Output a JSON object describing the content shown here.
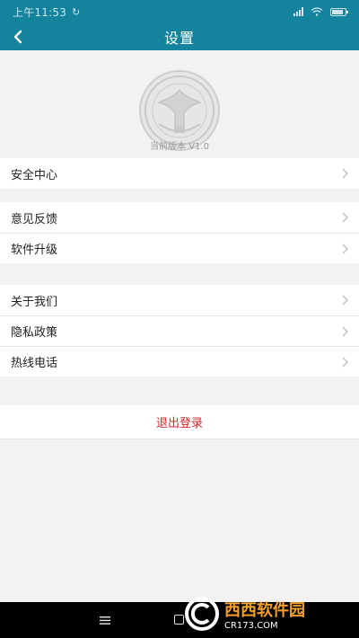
{
  "status_bar": {
    "time": "上午11:53",
    "battery_level": 0.85
  },
  "header": {
    "title": "设置"
  },
  "about": {
    "version": "当前版本  V1.0"
  },
  "groups": [
    {
      "items": [
        {
          "label": "安全中心"
        }
      ]
    },
    {
      "items": [
        {
          "label": "意见反馈"
        },
        {
          "label": "软件升级"
        }
      ]
    },
    {
      "items": [
        {
          "label": "关于我们"
        },
        {
          "label": "隐私政策"
        },
        {
          "label": "热线电话"
        }
      ]
    }
  ],
  "logout": {
    "label": "退出登录"
  },
  "watermark": {
    "title": "西西软件园",
    "subtitle": "CR173.COM"
  },
  "colors": {
    "primary": "#14849e",
    "danger": "#d9262b",
    "background": "#f2f2f2",
    "watermark": "#f3a12a"
  },
  "icons": {
    "back": "chevron-left-icon",
    "row": "chevron-right-icon",
    "logo": "emblem-icon",
    "nav_menu": "menu-icon",
    "nav_home": "home-icon"
  }
}
